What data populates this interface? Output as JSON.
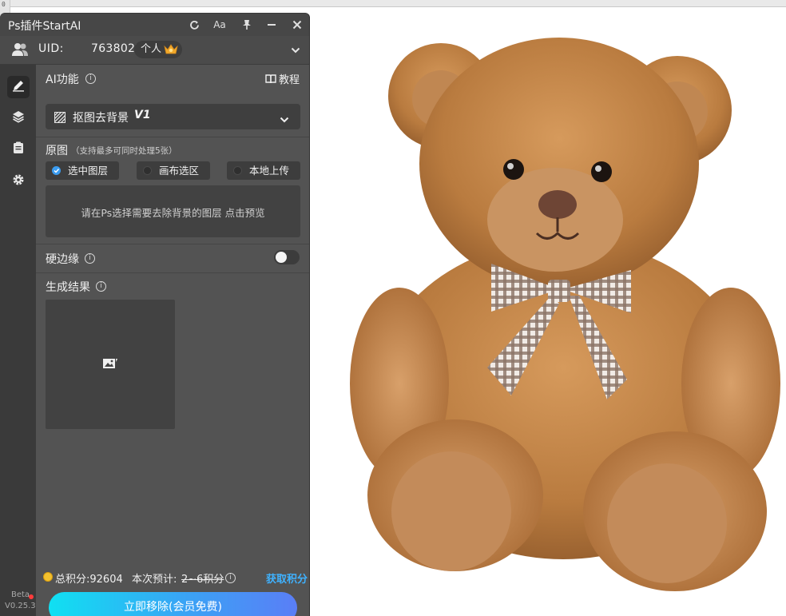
{
  "canvas": {
    "ruler_mark": "0"
  },
  "window": {
    "title": "Ps插件StartAI",
    "controls": {
      "refresh_icon": "refresh-icon",
      "font_btn_label": "Aa",
      "pin_icon": "pin-icon",
      "minimize_icon": "minimize-icon",
      "close_icon": "close-icon"
    }
  },
  "user": {
    "uid_label": "UID:",
    "uid_value": "763802291",
    "plan": "个人"
  },
  "sidebar": {
    "items": [
      {
        "name": "edit",
        "icon": "edit-icon",
        "active": true
      },
      {
        "name": "layers",
        "icon": "layers-icon",
        "active": false
      },
      {
        "name": "clipboard",
        "icon": "clipboard-icon",
        "active": false
      },
      {
        "name": "settings",
        "icon": "gear-icon",
        "active": false
      }
    ],
    "beta": "Beta",
    "version": "V0.25.3"
  },
  "ai_function": {
    "label": "AI功能",
    "tutorial_label": "教程",
    "selected_feature": "抠图去背景",
    "feature_version": "V1"
  },
  "source": {
    "label": "原图",
    "hint": "（支持最多可同时处理5张）",
    "options": [
      {
        "label": "选中图层",
        "checked": true
      },
      {
        "label": "画布选区",
        "checked": false
      },
      {
        "label": "本地上传",
        "checked": false
      }
    ],
    "preview_hint": "请在Ps选择需要去除背景的图层 点击预览"
  },
  "hard_edge": {
    "label": "硬边缘",
    "enabled": false
  },
  "result": {
    "label": "生成结果"
  },
  "footer": {
    "total_points": "总积分:92604",
    "estimate_label": "本次预计:",
    "estimate_value": "2~6积分",
    "get_points": "获取积分",
    "primary_button": "立即移除(会员免费)"
  },
  "colors": {
    "accent": "#3b9cf0",
    "link": "#3fb2ff",
    "coin": "#f3c12e",
    "toggle_knob": "#f5f5f5"
  }
}
